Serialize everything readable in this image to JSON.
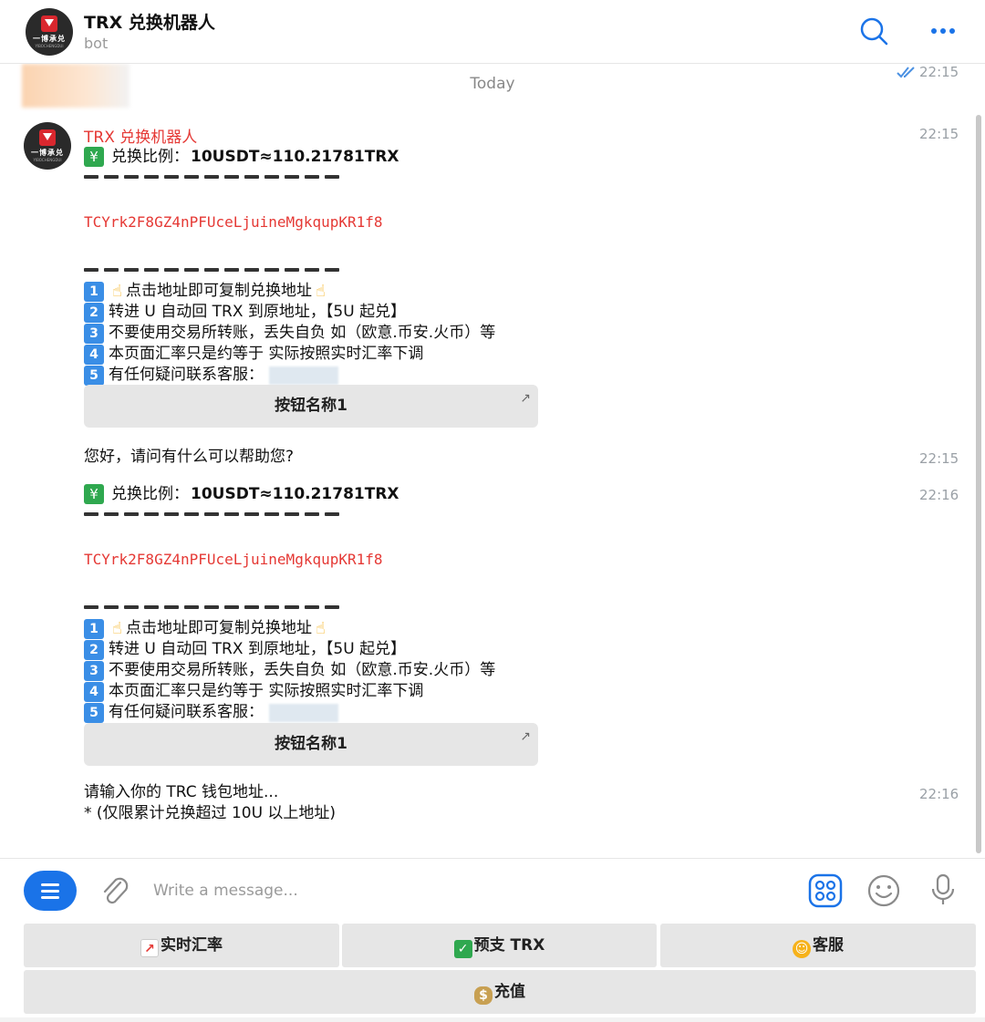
{
  "header": {
    "title": "TRX 兑换机器人",
    "subtitle": "bot",
    "avatar_text": "一博承兑",
    "avatar_subtext": "YIBOCHENGDUI"
  },
  "chat": {
    "sent_time": "22:15",
    "date_separator": "Today",
    "sender_name": "TRX 兑换机器人",
    "messages": [
      {
        "time": "22:15",
        "rate_label": "兑换比例：",
        "rate_value": "10USDT≈110.21781TRX",
        "address": "TCYrk2F8GZ4nPFUceLjuineMgkqupKR1f8",
        "steps": [
          {
            "num": "1",
            "text": "点击地址即可复制兑换地址"
          },
          {
            "num": "2",
            "text": "转进 U 自动回 TRX 到原地址，【5U 起兑】"
          },
          {
            "num": "3",
            "text": "不要使用交易所转账，丢失自负 如（欧意.币安.火币）等"
          },
          {
            "num": "4",
            "text": "本页面汇率只是约等于 实际按照实时汇率下调"
          },
          {
            "num": "5",
            "text": "有任何疑问联系客服："
          }
        ],
        "button_label": "按钮名称1"
      },
      {
        "time": "22:15",
        "text": "您好，请问有什么可以帮助您?"
      },
      {
        "time": "22:16",
        "rate_label": "兑换比例：",
        "rate_value": "10USDT≈110.21781TRX",
        "address": "TCYrk2F8GZ4nPFUceLjuineMgkqupKR1f8",
        "steps": [
          {
            "num": "1",
            "text": "点击地址即可复制兑换地址"
          },
          {
            "num": "2",
            "text": "转进 U 自动回 TRX 到原地址，【5U 起兑】"
          },
          {
            "num": "3",
            "text": "不要使用交易所转账，丢失自负 如（欧意.币安.火币）等"
          },
          {
            "num": "4",
            "text": "本页面汇率只是约等于 实际按照实时汇率下调"
          },
          {
            "num": "5",
            "text": "有任何疑问联系客服："
          }
        ],
        "button_label": "按钮名称1"
      },
      {
        "time": "22:16",
        "line1": "请输入你的 TRC 钱包地址...",
        "line2": "* (仅限累计兑换超过 10U 以上地址)"
      }
    ]
  },
  "input": {
    "placeholder": "Write a message..."
  },
  "keyboard": {
    "row1": [
      {
        "label": "实时汇率",
        "icon": "chart-icon"
      },
      {
        "label": "预支 TRX",
        "icon": "check-icon"
      },
      {
        "label": "客服",
        "icon": "person-icon"
      }
    ],
    "row2": [
      {
        "label": "充值",
        "icon": "money-bag-icon"
      }
    ]
  },
  "colors": {
    "accent": "#1a73e8",
    "sender": "#e53935",
    "address": "#e53935",
    "button_bg": "#e6e6e6"
  }
}
